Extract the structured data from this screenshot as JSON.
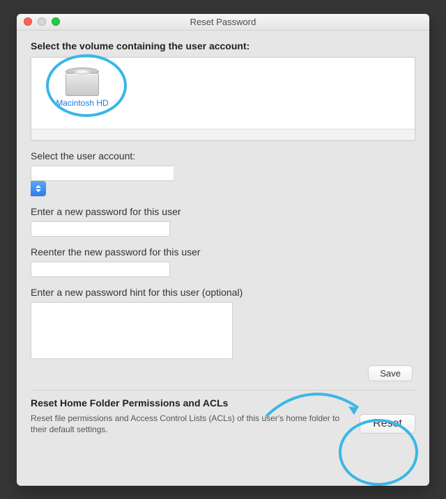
{
  "window": {
    "title": "Reset Password"
  },
  "volume": {
    "heading": "Select the volume containing the user account:",
    "selected_name": "Macintosh HD"
  },
  "account": {
    "label": "Select the user account:",
    "selected": ""
  },
  "password": {
    "new_label": "Enter a new password for this user",
    "new_value": "",
    "reenter_label": "Reenter the new password for this user",
    "reenter_value": "",
    "hint_label": "Enter a new password hint for this user (optional)",
    "hint_value": ""
  },
  "buttons": {
    "save": "Save",
    "reset": "Reset"
  },
  "permissions": {
    "title": "Reset Home Folder Permissions and ACLs",
    "description": "Reset file permissions and Access Control Lists (ACLs) of this user's home folder to their default settings."
  },
  "annotation_color": "#39b7e6"
}
